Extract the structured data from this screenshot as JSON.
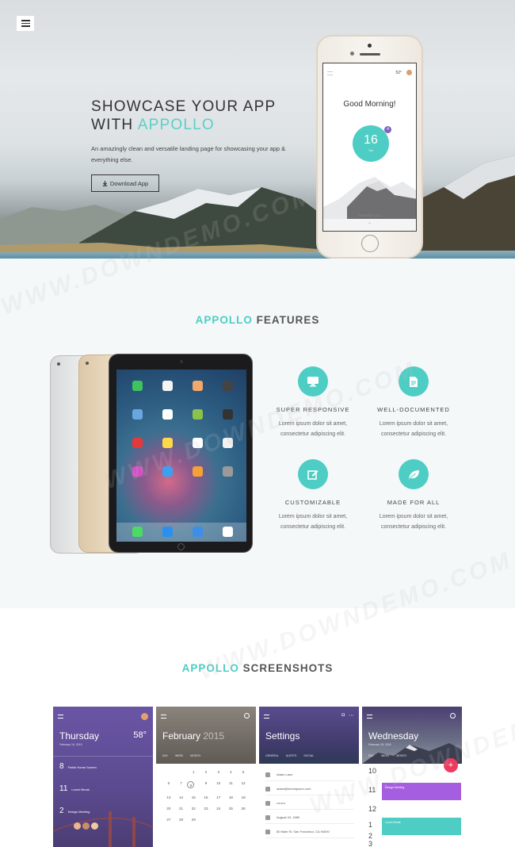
{
  "menu": {
    "icon": "hamburger-icon"
  },
  "hero": {
    "title_line1": "SHOWCASE YOUR APP",
    "title_with": "WITH ",
    "title_accent": "APPOLLO",
    "description": "An amazingly clean and versatile landing page for showcasing your app & everything else.",
    "download_label": "Download App",
    "download_icon": "download-icon"
  },
  "phone": {
    "temp": "52°",
    "greeting": "Good Morning!",
    "number": "16",
    "number_sub": "Tue",
    "badge": "4",
    "month": "FEBRUARY 2015",
    "chevron": "⌄"
  },
  "features": {
    "title_accent": "APPOLLO",
    "title_rest": " FEATURES",
    "items": [
      {
        "icon": "monitor-icon",
        "title": "SUPER RESPONSIVE",
        "desc1": "Lorem ipsum dolor sit amet,",
        "desc2": "consectetur adipiscing elit."
      },
      {
        "icon": "document-icon",
        "title": "WELL-DOCUMENTED",
        "desc1": "Lorem ipsum dolor sit amet,",
        "desc2": "consectetur adipiscing elit."
      },
      {
        "icon": "edit-icon",
        "title": "CUSTOMIZABLE",
        "desc1": "Lorem ipsum dolor sit amet,",
        "desc2": "consectetur adipiscing elit."
      },
      {
        "icon": "leaf-icon",
        "title": "MADE FOR ALL",
        "desc1": "Lorem ipsum dolor sit amet,",
        "desc2": "consectetur adipiscing elit."
      }
    ]
  },
  "screenshots": {
    "title_accent": "APPOLLO",
    "title_rest": " SCREENSHOTS",
    "thursday": {
      "title": "Thursday",
      "date": "February 19, 2015",
      "temp": "58°",
      "rows": [
        {
          "num": "8",
          "text": "Finish Home Screen"
        },
        {
          "num": "11",
          "text": "Lunch Break"
        },
        {
          "num": "2",
          "text": "Design Meeting"
        }
      ]
    },
    "february": {
      "title": "February",
      "year": "2015",
      "tabs": [
        "DAY",
        "WEEK",
        "MONTH"
      ],
      "days": [
        "1",
        "2",
        "3",
        "4",
        "5",
        "6",
        "7",
        "8",
        "9",
        "10",
        "11",
        "12",
        "13",
        "14",
        "15",
        "16",
        "17",
        "18",
        "19",
        "20",
        "21",
        "22",
        "23",
        "24",
        "25",
        "26",
        "27",
        "28",
        "29"
      ]
    },
    "settings": {
      "title": "Settings",
      "tabs": [
        "GENERAL",
        "ALERTS",
        "SOCIAL"
      ],
      "rows": [
        "Adam Lane",
        "adam@loremipsum.com",
        "••••••••",
        "August 24, 1980",
        "80 Main St. San Francisco, CA 94000"
      ]
    },
    "wednesday": {
      "title": "Wednesday",
      "date": "February 18, 2015",
      "tabs": [
        "DAY",
        "WEEK",
        "MONTH"
      ],
      "days": [
        "10",
        "11",
        "12",
        "1",
        "2",
        "3"
      ],
      "card1": "Design Meeting",
      "card2": "Lunch Break",
      "fab": "+"
    }
  },
  "colors": {
    "accent": "#4ecdc4",
    "purple": "#6f5aa8",
    "red": "#ee3a5f"
  },
  "watermark": "WWW.DOWNDEMO.COM"
}
